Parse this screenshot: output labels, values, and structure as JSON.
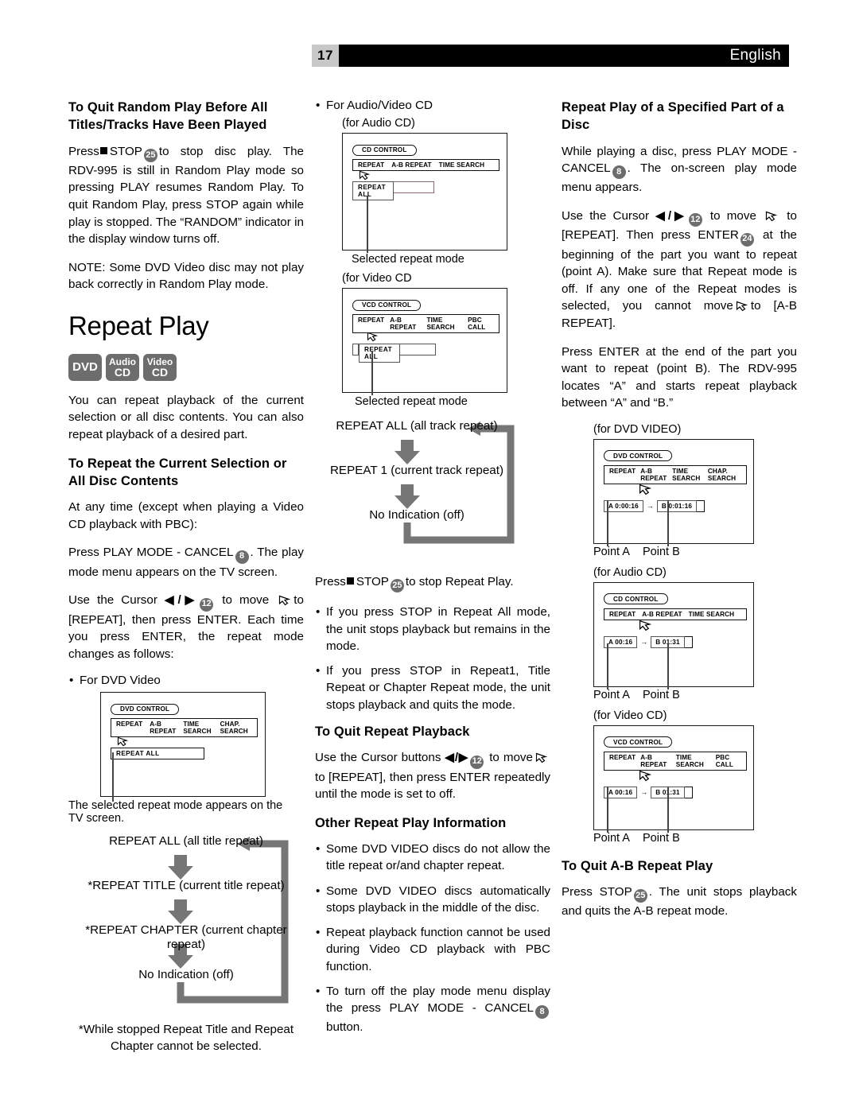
{
  "header": {
    "page_number": "17",
    "language": "English"
  },
  "left_column": {
    "heading1": "To Quit Random Play Before All Titles/Tracks Have Been Played",
    "para1_a": "Press",
    "para1_stop": "STOP",
    "para1_chip": "25",
    "para1_b": "to stop disc play. The RDV-995 is still in Random Play mode so pressing PLAY resumes Random Play. To quit Random Play, press STOP again while play is stopped. The “RANDOM” indicator in the display window turns off.",
    "para2": "NOTE: Some DVD Video disc may not play back correctly in Random Play mode.",
    "big_title": "Repeat Play",
    "badges": [
      {
        "line1": "",
        "line2": "DVD"
      },
      {
        "line1": "Audio",
        "line2": "CD"
      },
      {
        "line1": "Video",
        "line2": "CD"
      }
    ],
    "para3": "You can repeat playback of the current selection or all disc contents. You can also repeat playback of a desired part.",
    "heading2": "To Repeat the Current Selection or All Disc Contents",
    "para4": "At any time (except when playing a Video CD playback with PBC):",
    "para5_a": "Press PLAY MODE - CANCEL",
    "para5_chip": "8",
    "para5_b": ". The play mode menu appears on the TV screen.",
    "para6_a": "Use the Cursor",
    "para6_arrows": "◀/▶",
    "para6_chip": "12",
    "para6_b": "to move",
    "para6_c": "to [REPEAT], then press ENTER. Each time you press ENTER, the repeat mode changes as follows:",
    "bullet_dvd": "For DVD Video",
    "screen_dvd": {
      "control_label": "DVD CONTROL",
      "menu_items": [
        "REPEAT",
        "A-B REPEAT",
        "TIME SEARCH",
        "CHAP. SEARCH"
      ],
      "mode_text": "REPEAT  ALL",
      "caption": "The selected repeat mode appears on the TV screen."
    },
    "flow_dvd": {
      "steps": [
        "REPEAT ALL (all title repeat)",
        "*REPEAT TITLE (current title repeat)",
        "*REPEAT CHAPTER (current chapter repeat)",
        "No Indication (off)"
      ],
      "note": "*While stopped Repeat Title and Repeat Chapter cannot be selected."
    }
  },
  "middle_column": {
    "bullet_avcd": "For Audio/Video CD",
    "screen_audio": {
      "caption_top": "(for Audio CD)",
      "control_label": "CD CONTROL",
      "menu_items": [
        "REPEAT",
        "A-B REPEAT",
        "TIME SEARCH"
      ],
      "mode_text": "REPEAT  ALL",
      "caption": "Selected repeat mode"
    },
    "screen_video": {
      "caption_top": "(for Video CD",
      "control_label": "VCD CONTROL",
      "menu_items": [
        "REPEAT",
        "A-B REPEAT",
        "TIME SEARCH",
        "PBC CALL"
      ],
      "mode_text": "REPEAT  ALL",
      "caption": "Selected repeat mode"
    },
    "flow_cd": {
      "steps": [
        "REPEAT ALL (all track repeat)",
        "REPEAT 1 (current track repeat)",
        "No Indication (off)"
      ]
    },
    "stop_line_a": "Press",
    "stop_line_stop": "STOP",
    "stop_line_chip": "25",
    "stop_line_b": "to stop Repeat Play.",
    "bullets1": [
      "If you press STOP in Repeat All mode, the unit stops playback but remains in the mode.",
      "If you press STOP in Repeat1, Title Repeat or Chapter Repeat mode, the unit stops playback and quits the mode."
    ],
    "heading_quit": "To Quit Repeat Playback",
    "quit_a": "Use the Cursor buttons",
    "quit_arrows": "◀/▶",
    "quit_chip": "12",
    "quit_b": "to move",
    "quit_c": "to [REPEAT], then press ENTER repeatedly until the mode is set to off.",
    "heading_other": "Other Repeat Play Information",
    "bullets2": [
      "Some DVD VIDEO discs do not allow the title repeat or/and chapter repeat.",
      "Some DVD VIDEO discs automatically stops playback in the middle of the disc.",
      "Repeat playback function cannot be used during Video CD playback with PBC function."
    ],
    "bullet_last_a": "To turn off the play mode menu display the press PLAY MODE - CANCEL",
    "bullet_last_chip": "8",
    "bullet_last_b": "button."
  },
  "right_column": {
    "heading1": "Repeat Play of a Specified Part of a Disc",
    "para1_a": "While playing a disc, press PLAY MODE - CANCEL",
    "para1_chip": "8",
    "para1_b": ". The on-screen play mode menu appears.",
    "para2_a": "Use the Cursor",
    "para2_arrows": "◀/▶",
    "para2_chip12": "12",
    "para2_b": "to move",
    "para2_c": "to [REPEAT]. Then press ENTER",
    "para2_chip24": "24",
    "para2_d": "at the beginning of the part you want to repeat (point A). Make sure that Repeat mode is off. If any one of the Repeat modes is selected, you cannot move",
    "para2_e": "to [A-B REPEAT].",
    "para3": "Press ENTER at the end of the part you want to repeat (point B). The RDV-995 locates “A” and starts repeat playback between “A” and “B.”",
    "screen_dvd": {
      "caption_top": "(for DVD VIDEO)",
      "control_label": "DVD CONTROL",
      "menu_items": [
        "REPEAT",
        "A-B REPEAT",
        "TIME SEARCH",
        "CHAP. SEARCH"
      ],
      "point_a": "A 0:00:16",
      "arrow": "→",
      "point_b": "B 0:01:16",
      "label_a": "Point A",
      "label_b": "Point B"
    },
    "screen_audio": {
      "caption_top": "(for Audio CD)",
      "control_label": "CD CONTROL",
      "menu_items": [
        "REPEAT",
        "A-B REPEAT",
        "TIME SEARCH"
      ],
      "point_a": "A   00:16",
      "arrow": "→",
      "point_b": "B   01:31",
      "label_a": "Point A",
      "label_b": "Point B"
    },
    "screen_video": {
      "caption_top": "(for Video CD)",
      "control_label": "VCD CONTROL",
      "menu_items": [
        "REPEAT",
        "A-B REPEAT",
        "TIME SEARCH",
        "PBC CALL"
      ],
      "point_a": "A   00:16",
      "arrow": "→",
      "point_b": "B   01:31",
      "label_a": "Point A",
      "label_b": "Point B"
    },
    "heading_quit_ab": "To Quit A-B Repeat Play",
    "quit_a": "Press STOP",
    "quit_chip": "25",
    "quit_b": ". The unit stops playback and quits the A-B repeat mode."
  },
  "colors": {
    "chip_gray": "#6d6d6d",
    "header_black": "#000000",
    "page_num_gray": "#c8c8c8",
    "flow_arrow_gray": "#767676"
  }
}
